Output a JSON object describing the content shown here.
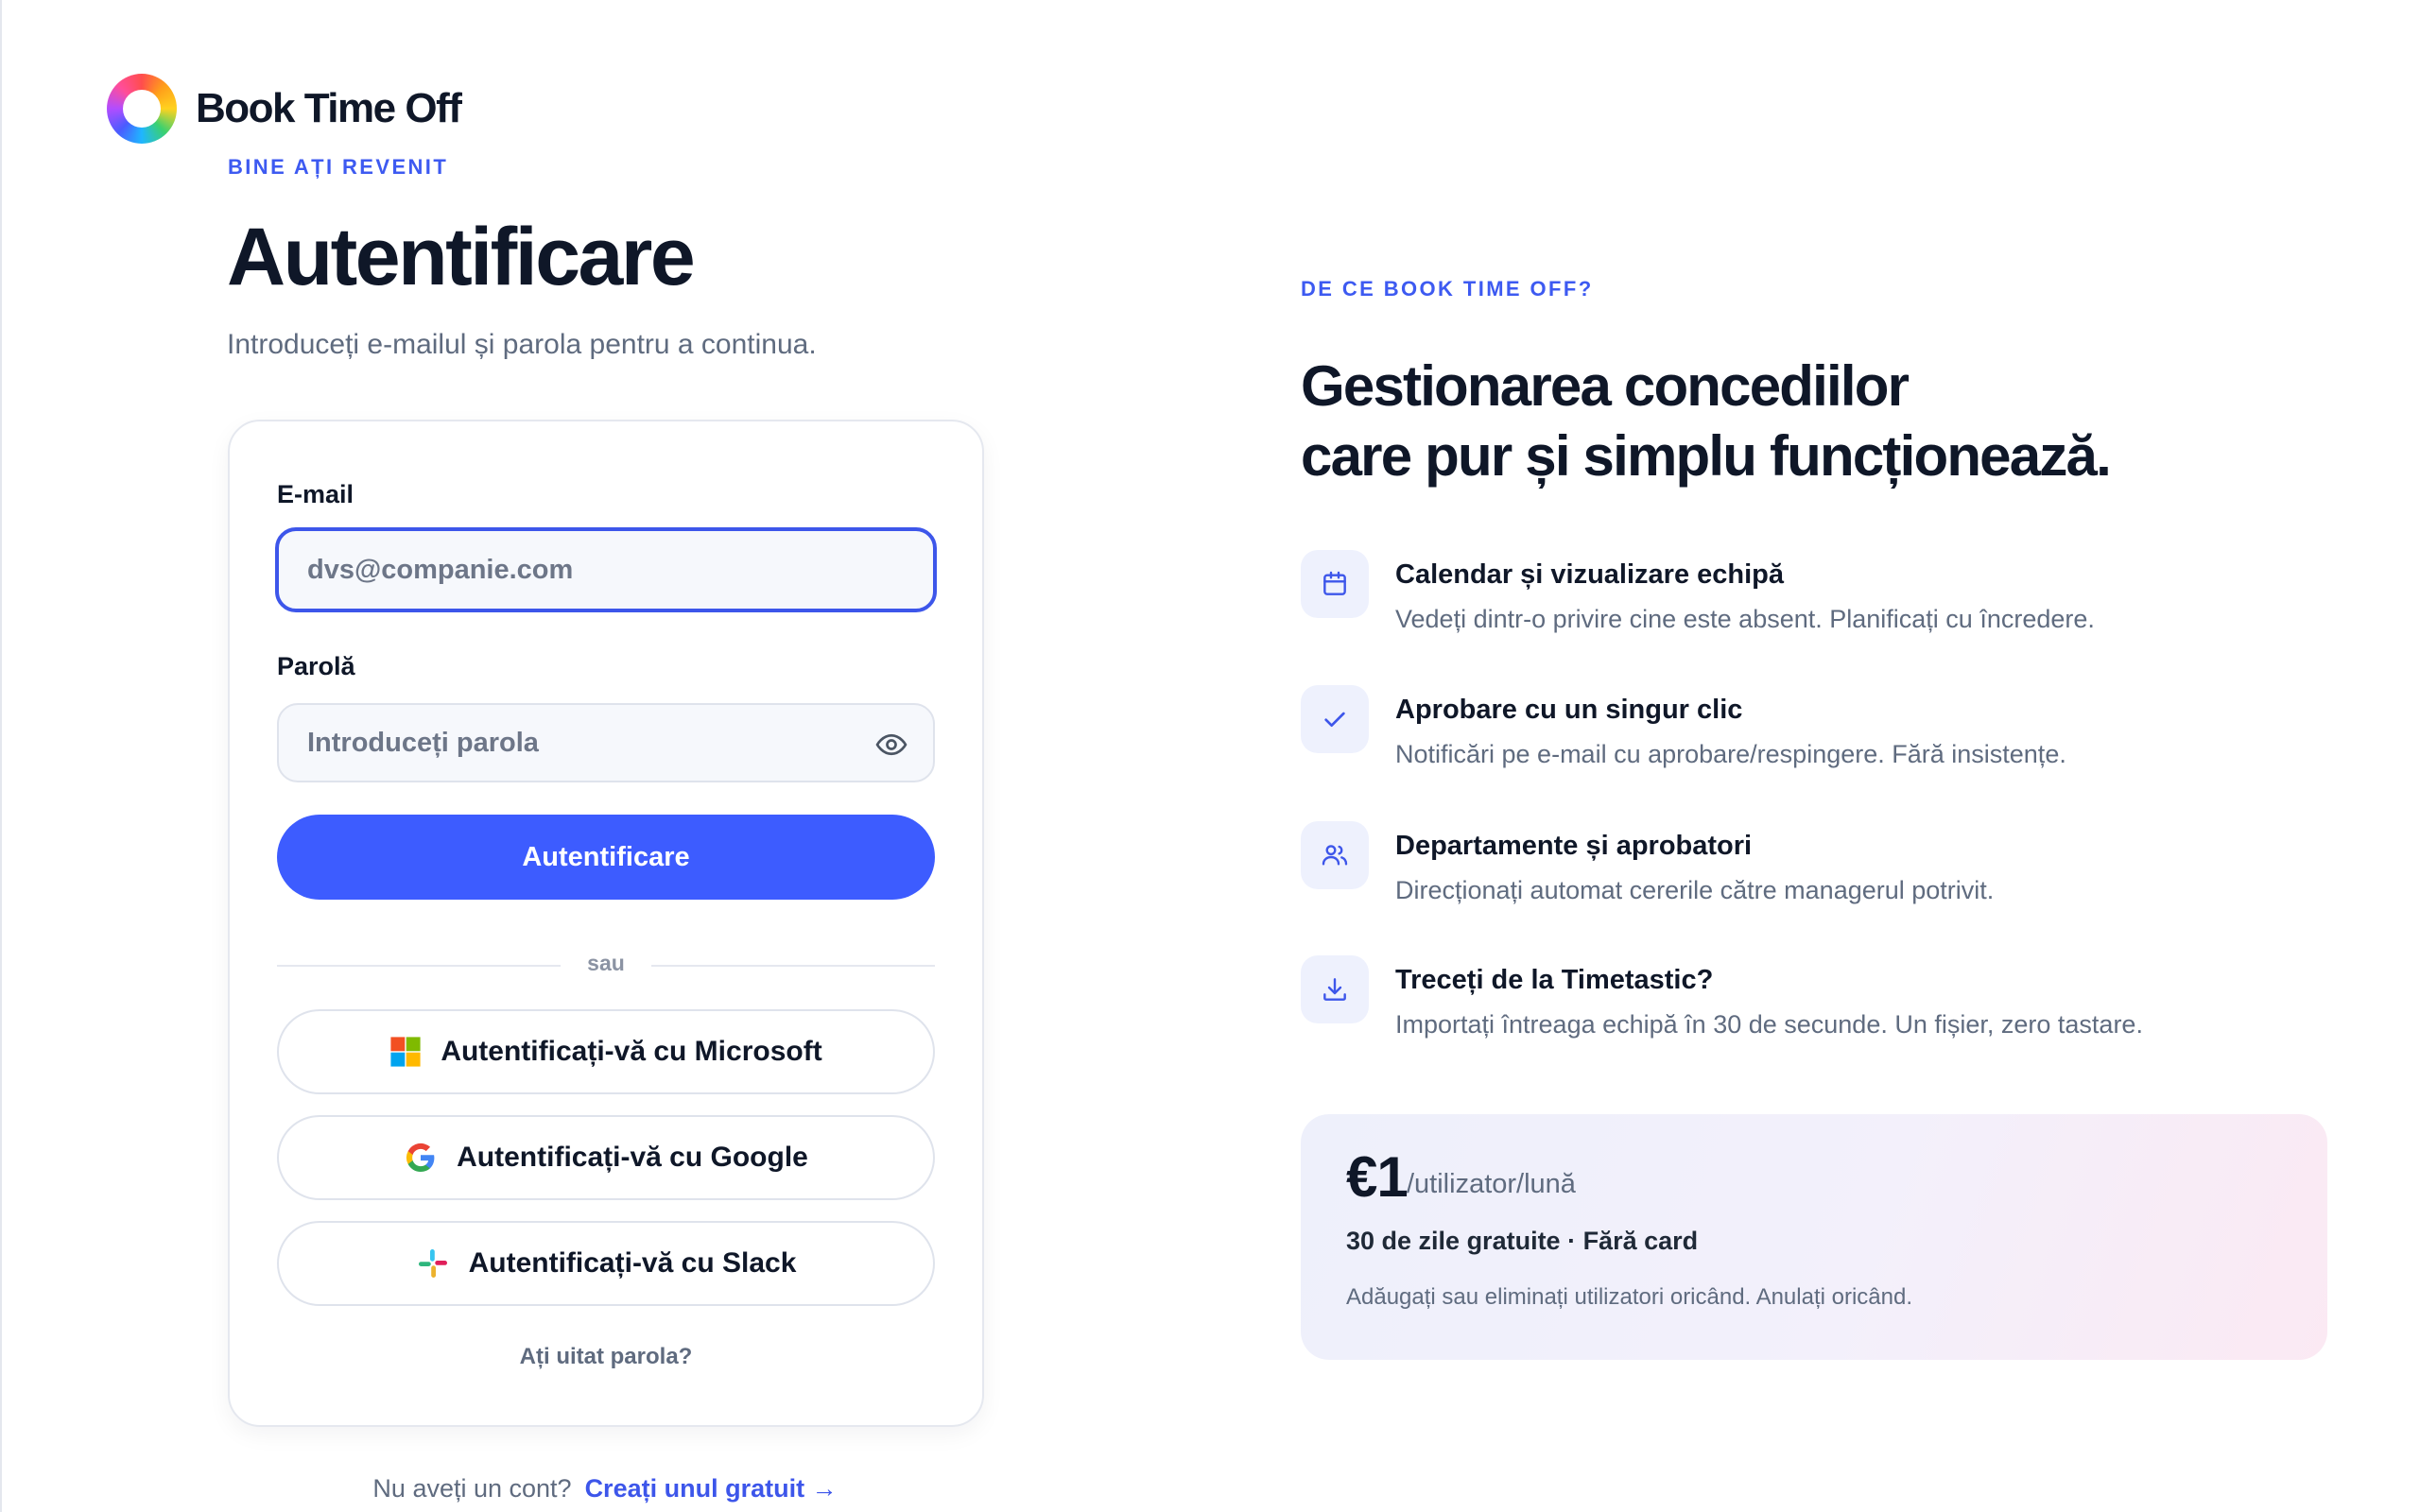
{
  "brand": {
    "name": "Book Time Off"
  },
  "login": {
    "eyebrow": "BINE AȚI REVENIT",
    "title": "Autentificare",
    "subtitle": "Introduceți e-mailul și parola pentru a continua.",
    "email_label": "E-mail",
    "email_placeholder": "dvs@companie.com",
    "password_label": "Parolă",
    "password_placeholder": "Introduceți parola",
    "submit_label": "Autentificare",
    "divider_text": "sau",
    "sso": {
      "microsoft": "Autentificați-vă cu Microsoft",
      "google": "Autentificați-vă cu Google",
      "slack": "Autentificați-vă cu Slack"
    },
    "forgot_password": "Ați uitat parola?",
    "signup_prompt": "Nu aveți un cont?",
    "signup_link": "Creați unul gratuit →"
  },
  "why": {
    "eyebrow": "DE CE BOOK TIME OFF?",
    "title_line1": "Gestionarea concediilor",
    "title_line2": "care pur și simplu funcționează.",
    "features": [
      {
        "icon": "calendar-icon",
        "title": "Calendar și vizualizare echipă",
        "desc": "Vedeți dintr-o privire cine este absent. Planificați cu încredere."
      },
      {
        "icon": "check-icon",
        "title": "Aprobare cu un singur clic",
        "desc": "Notificări pe e-mail cu aprobare/respingere. Fără insistențe."
      },
      {
        "icon": "users-icon",
        "title": "Departamente și aprobatori",
        "desc": "Direcționați automat cererile către managerul potrivit."
      },
      {
        "icon": "download-icon",
        "title": "Treceți de la Timetastic?",
        "desc": "Importați întreaga echipă în 30 de secunde. Un fișier, zero tastare."
      }
    ]
  },
  "pricing": {
    "amount": "€1",
    "unit": "/utilizator/lună",
    "trial": "30 de zile gratuite · Fără card",
    "note": "Adăugați sau eliminați utilizatori oricând. Anulați oricând."
  },
  "colors": {
    "accent": "#3d5cff",
    "accent_text": "#3d56ea",
    "text": "#0f1728",
    "muted": "#5f6b7f"
  }
}
